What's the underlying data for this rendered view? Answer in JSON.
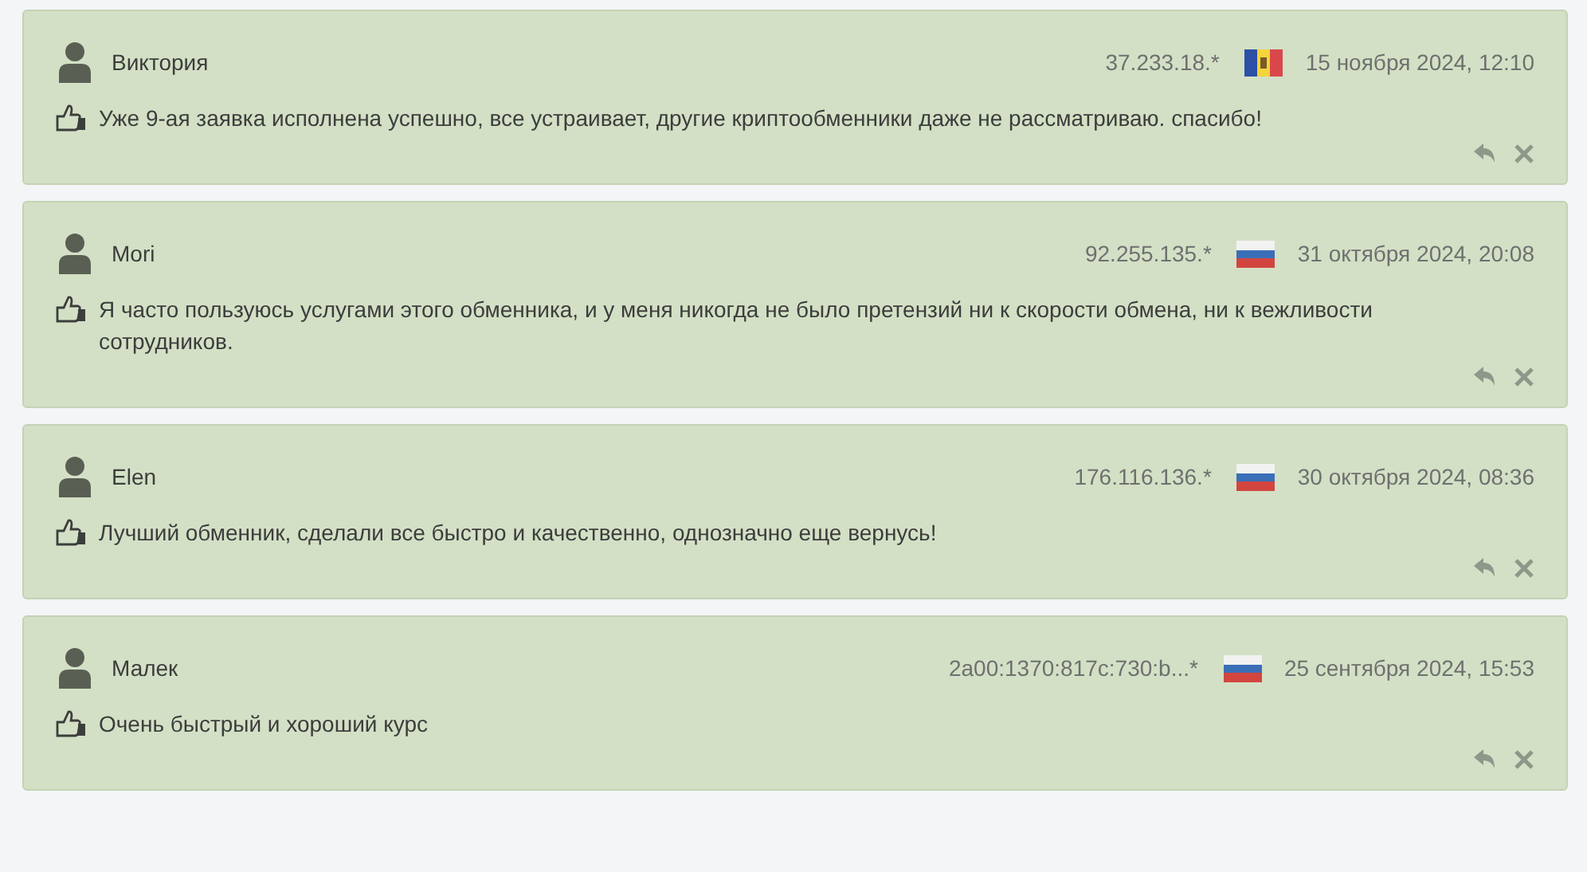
{
  "reviews": [
    {
      "author": "Виктория",
      "ip": "37.233.18.*",
      "flag": {
        "kind": "moldova"
      },
      "date": "15 ноября 2024, 12:10",
      "text": "Уже 9-ая заявка исполнена успешно, все устраивает, другие криптообменники даже не рассматриваю. спасибо!"
    },
    {
      "author": "Mori",
      "ip": "92.255.135.*",
      "flag": {
        "kind": "russia"
      },
      "date": "31 октября 2024, 20:08",
      "text": "Я часто пользуюсь услугами этого обменника, и у меня никогда не было претензий ни к скорости обмена, ни к вежливости сотрудников."
    },
    {
      "author": "Elen",
      "ip": "176.116.136.*",
      "flag": {
        "kind": "russia"
      },
      "date": "30 октября 2024, 08:36",
      "text": "Лучший обменник, сделали все быстро и качественно, однозначно еще вернусь!"
    },
    {
      "author": "Малек",
      "ip": "2a00:1370:817c:730:b...*",
      "flag": {
        "kind": "russia"
      },
      "date": "25 сентября 2024, 15:53",
      "text": "Очень быстрый и хороший курс"
    }
  ]
}
